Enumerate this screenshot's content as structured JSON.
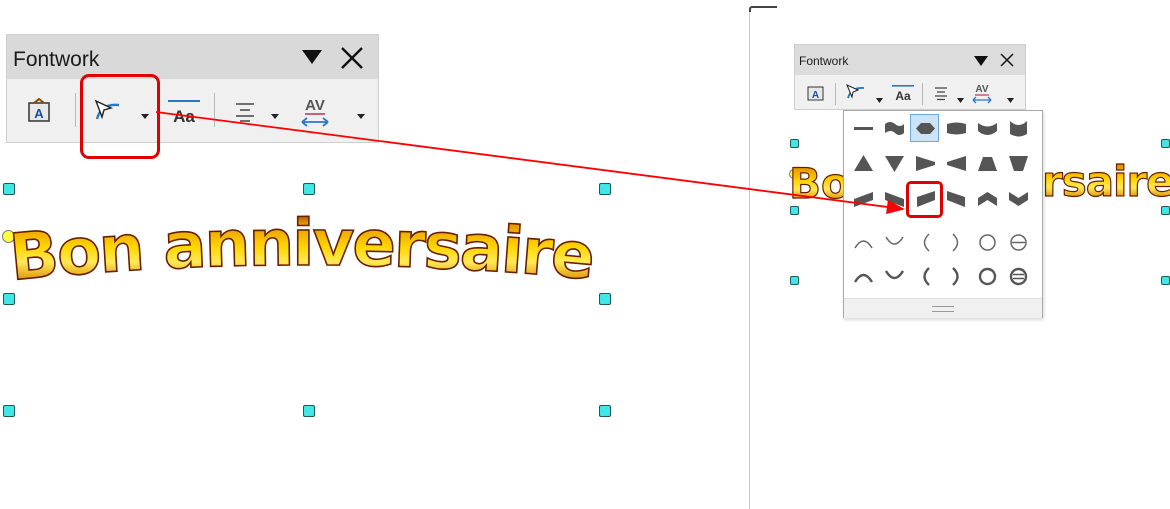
{
  "left_toolbar": {
    "title": "Fontwork",
    "menu_icon": "triangle-down-icon",
    "close_icon": "close-icon"
  },
  "left_text": "Bon anniversaire",
  "right_toolbar": {
    "title": "Fontwork"
  },
  "right_text_left": "Bo",
  "right_text_right": "rsaire",
  "shape_palette": {
    "rows": 5,
    "columns": 6,
    "selected_row": 0,
    "selected_col": 2,
    "highlighted_row": 2,
    "highlighted_col": 2
  },
  "colors": {
    "highlight_red": "#e00000",
    "arrow_red": "#ff0000",
    "handle_cyan": "#3fe7e7",
    "text_gold": "#e8a000",
    "text_outline": "#6a1e00"
  }
}
